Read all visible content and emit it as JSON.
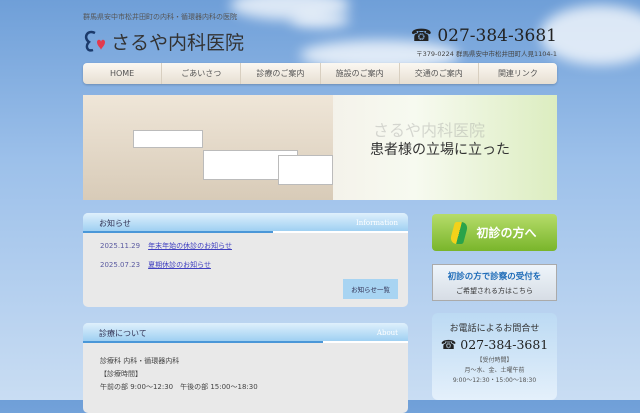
{
  "header": {
    "tagline": "群馬県安中市松井田町の内科・循環器内科の医院",
    "clinic_name": "さるや内科医院",
    "phone": "☎ 027-384-3681",
    "address": "〒379-0224 群馬県安中市松井田町人見1104-1"
  },
  "nav": [
    "HOME",
    "ごあいさつ",
    "診療のご案内",
    "施設のご案内",
    "交通のご案内",
    "関連リンク"
  ],
  "hero": {
    "caption": "患者様の立場に立った"
  },
  "news": {
    "title": "お知らせ",
    "title_en": "Information",
    "items": [
      {
        "date": "2025.11.29",
        "text": "年末年始の休診のお知らせ"
      },
      {
        "date": "2025.07.23",
        "text": "夏期休診のお知らせ"
      }
    ],
    "more": "お知らせ一覧"
  },
  "about": {
    "title": "診療について",
    "title_en": "About",
    "lines": [
      "診療科 内科・循環器内科",
      "【診療時間】",
      "午前の部 9:00〜12:30　午後の部 15:00〜18:30"
    ]
  },
  "side": {
    "first_visit": "初診の方へ",
    "reception_l1": "初診の方で診察の受付を",
    "reception_l2": "ご希望される方はこちら",
    "contact_title": "お電話によるお問合せ",
    "contact_phone": "☎ 027-384-3681",
    "hours_label": "【受付時間】",
    "hours_days": "月〜水、金、土曜午前",
    "hours_time": "9:00〜12:30・15:00〜18:30"
  }
}
